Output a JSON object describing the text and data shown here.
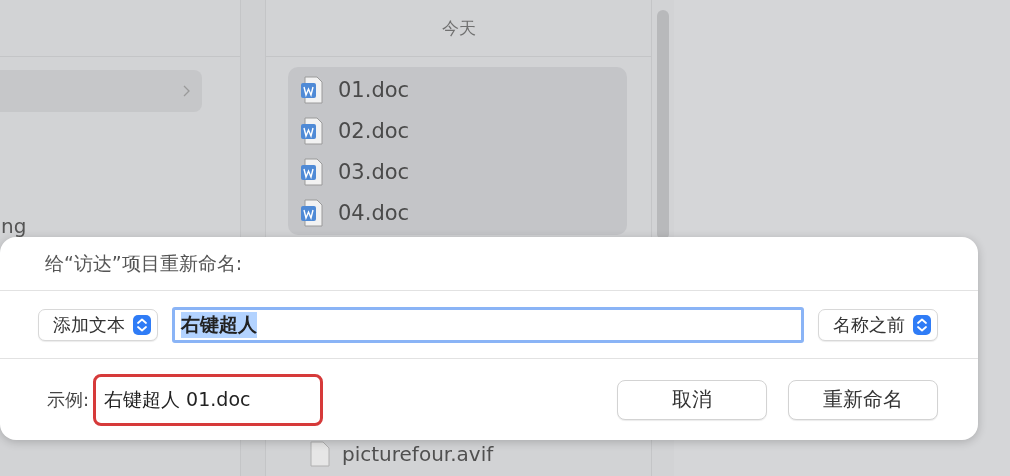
{
  "finder": {
    "left_column": {
      "highlighted_row": true,
      "partial_text": "ng"
    },
    "list_header": "今天",
    "files": [
      {
        "name": "01.doc",
        "selected": true
      },
      {
        "name": "02.doc",
        "selected": true
      },
      {
        "name": "03.doc",
        "selected": true
      },
      {
        "name": "04.doc",
        "selected": true
      }
    ],
    "file_below": "picturefour.avif"
  },
  "dialog": {
    "title": "给“访达”项目重新命名:",
    "mode_popup": "添加文本",
    "text_field": {
      "value": "右键超人",
      "text_selected": true
    },
    "position_popup": "名称之前",
    "example_label": "示例:",
    "example_value": "右键超人 01.doc",
    "example_highlighted": true,
    "buttons": [
      {
        "label": "取消"
      },
      {
        "label": "重新命名"
      }
    ]
  }
}
